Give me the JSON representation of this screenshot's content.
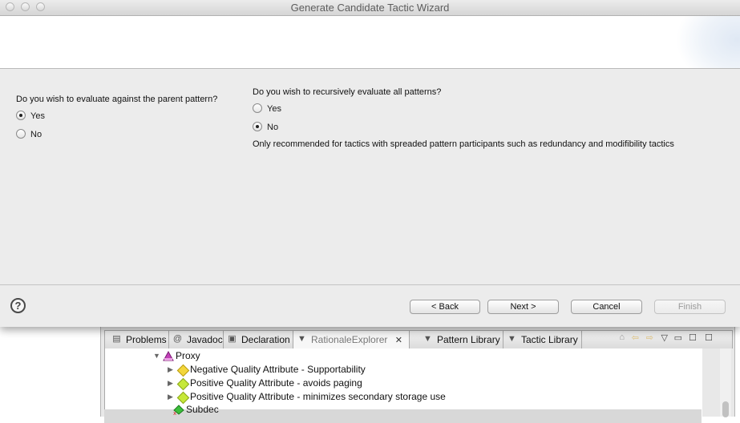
{
  "dialog": {
    "title": "Generate Candidate Tactic Wizard",
    "questions": [
      {
        "prompt": "Do you wish to evaluate against the parent pattern?",
        "options": [
          {
            "label": "Yes",
            "selected": true
          },
          {
            "label": "No",
            "selected": false
          }
        ]
      },
      {
        "prompt": "Do you wish to recursively evaluate all patterns?",
        "options": [
          {
            "label": "Yes",
            "selected": false
          },
          {
            "label": "No",
            "selected": true
          }
        ],
        "note": "Only recommended for tactics with spreaded pattern participants such as redundancy and modifibility tactics"
      }
    ],
    "buttons": {
      "help": "?",
      "back": "< Back",
      "next": "Next >",
      "cancel": "Cancel",
      "finish": "Finish"
    }
  },
  "ide": {
    "tabs": [
      {
        "label": "Problems",
        "icon": "problems-icon"
      },
      {
        "label": "Javadoc",
        "icon": "javadoc-icon"
      },
      {
        "label": "Declaration",
        "icon": "declaration-icon"
      },
      {
        "label": "RationaleExplorer",
        "icon": "rationale-explorer-icon",
        "active": true
      },
      {
        "label": "Pattern Library",
        "icon": "pattern-library-icon"
      },
      {
        "label": "Tactic Library",
        "icon": "tactic-library-icon"
      }
    ],
    "tree": [
      {
        "label": "Proxy",
        "icon": "pattern-icon",
        "expanded": true
      },
      {
        "label": "Negative Quality Attribute - Supportability",
        "icon": "negative-attribute-icon"
      },
      {
        "label": "Positive Quality Attribute - avoids paging",
        "icon": "positive-attribute-icon"
      },
      {
        "label": "Positive Quality Attribute - minimizes secondary storage use",
        "icon": "positive-attribute-icon"
      },
      {
        "label": "Subdec",
        "icon": "subdecision-icon"
      }
    ]
  }
}
